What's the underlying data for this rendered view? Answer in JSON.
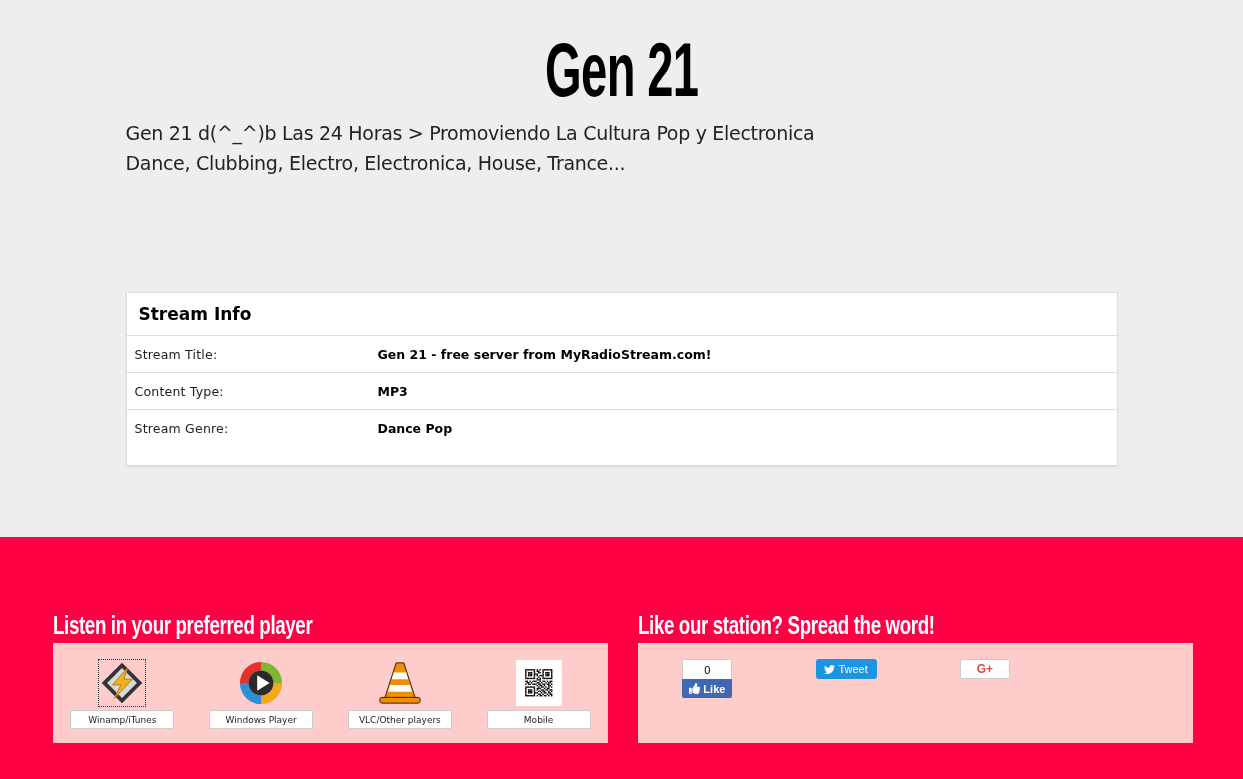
{
  "header": {
    "title": "Gen 21",
    "description": "Gen 21 d(^_^)b Las 24 Horas > Promoviendo La Cultura Pop y Electronica",
    "genres": "Dance, Clubbing, Electro, Electronica, House, Trance..."
  },
  "stream_info": {
    "title": "Stream Info",
    "rows": [
      {
        "label": "Stream Title:",
        "value": "Gen 21 - free server from MyRadioStream.com!"
      },
      {
        "label": "Content Type:",
        "value": "MP3"
      },
      {
        "label": "Stream Genre:",
        "value": "Dance Pop"
      }
    ]
  },
  "players": {
    "heading": "Listen in your preferred player",
    "items": [
      {
        "kind": "winamp",
        "label": "Winamp/iTunes",
        "focused": true
      },
      {
        "kind": "windows-media",
        "label": "Windows Player",
        "focused": false
      },
      {
        "kind": "vlc",
        "label": "VLC/Other players",
        "focused": false
      },
      {
        "kind": "qr",
        "label": "Mobile",
        "focused": false
      }
    ]
  },
  "share": {
    "heading": "Like our station? Spread the word!",
    "buttons": [
      {
        "kind": "facebook",
        "count": "0",
        "label": "Like"
      },
      {
        "kind": "twitter",
        "label": "Tweet"
      },
      {
        "kind": "google-plus",
        "label": "G+"
      }
    ]
  }
}
